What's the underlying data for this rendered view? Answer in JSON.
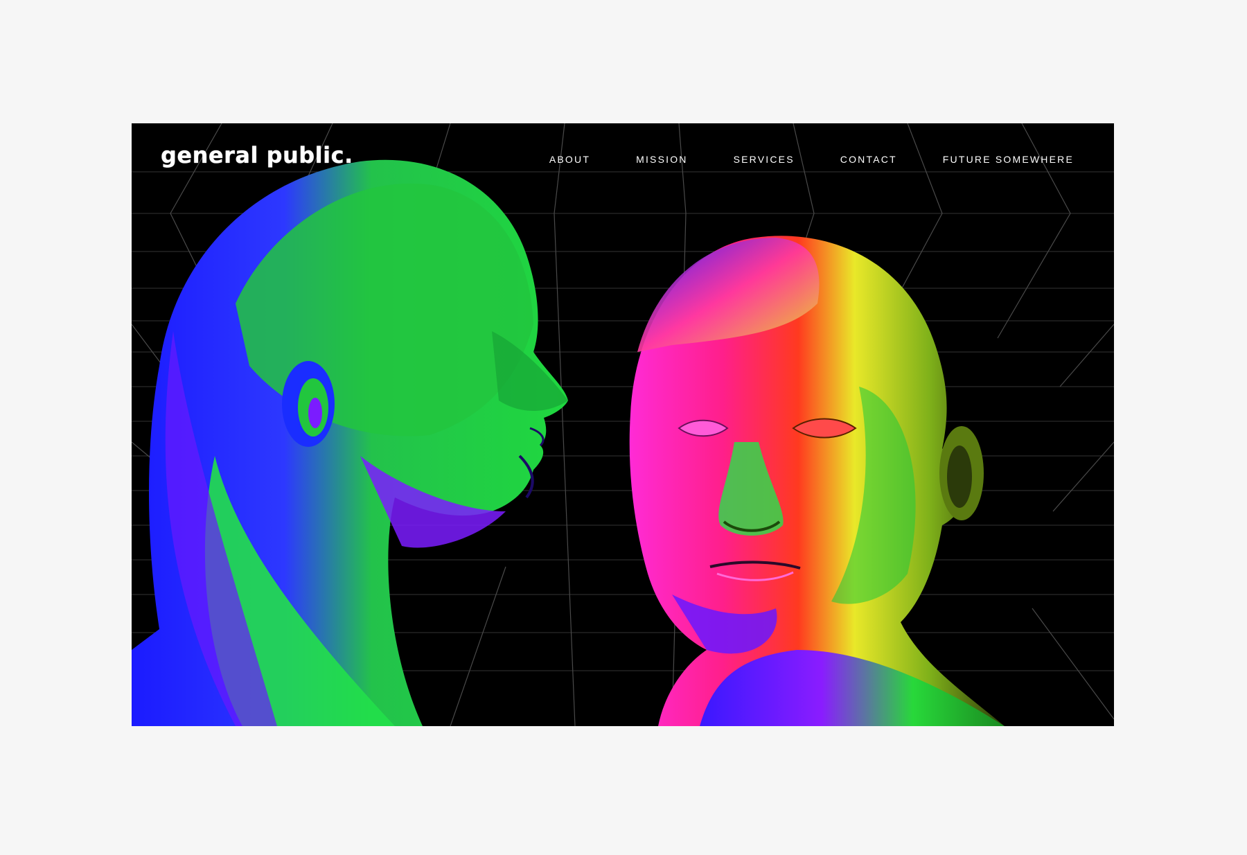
{
  "brand": {
    "logo_text": "general public."
  },
  "nav": {
    "items": [
      {
        "label": "ABOUT"
      },
      {
        "label": "MISSION"
      },
      {
        "label": "SERVICES"
      },
      {
        "label": "CONTACT"
      },
      {
        "label": "FUTURE SOMEWHERE"
      }
    ]
  },
  "colors": {
    "page_background": "#f6f6f6",
    "hero_background": "#000000",
    "text": "#ffffff",
    "grid_line": "#3a3a3a"
  },
  "hero": {
    "illustration": "two-iridescent-heads"
  }
}
